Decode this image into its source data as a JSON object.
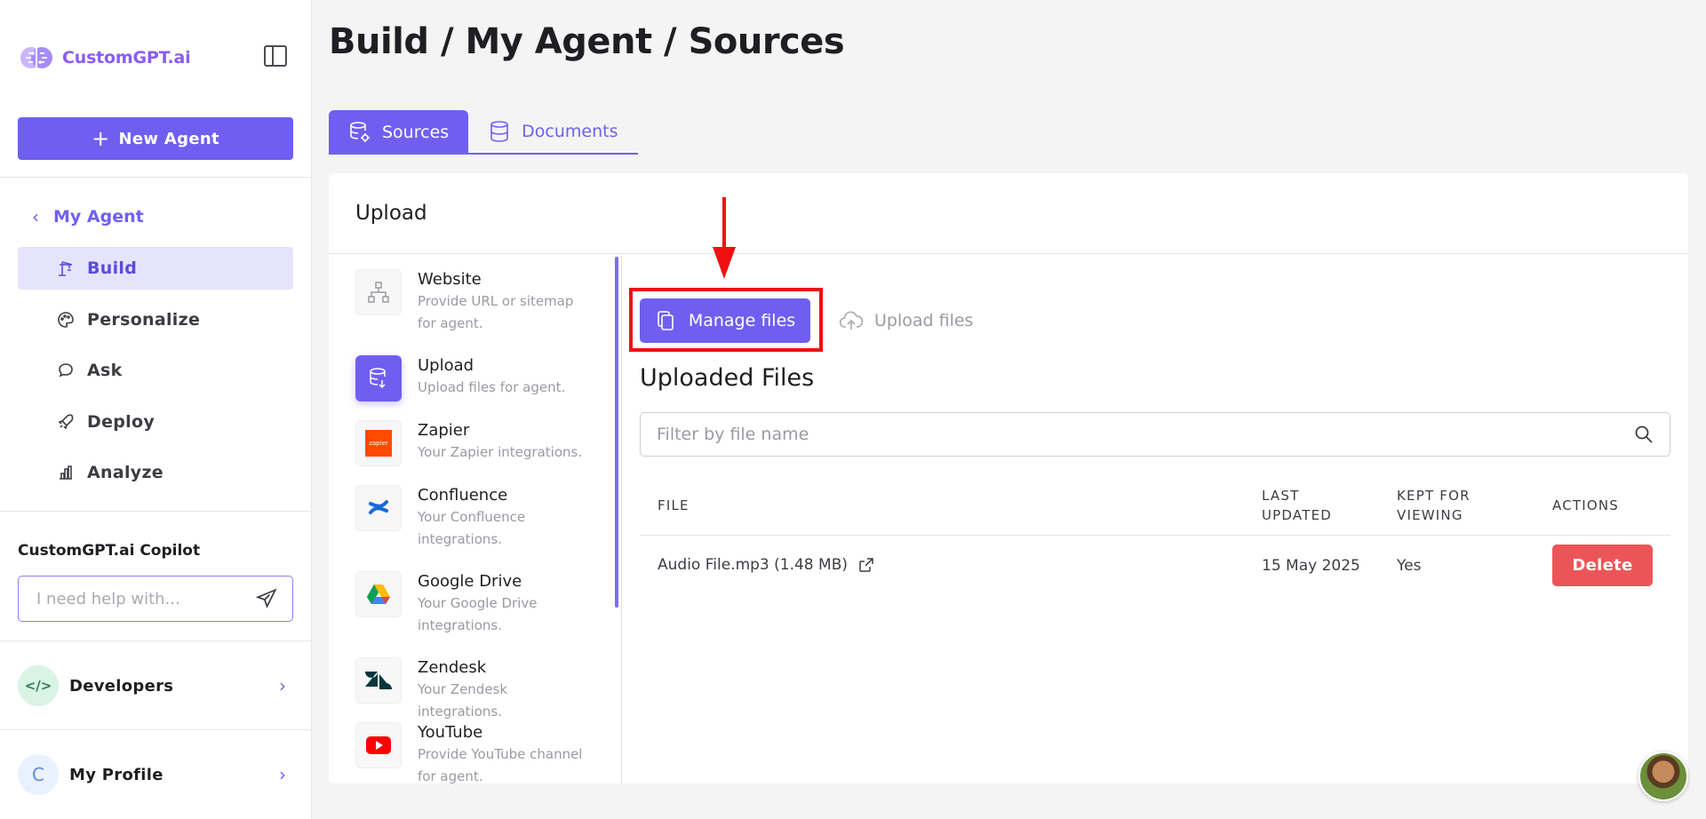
{
  "brand": {
    "name": "CustomGPT.ai"
  },
  "sidebar": {
    "new_agent_label": "New Agent",
    "back_label": "My Agent",
    "items": [
      {
        "label": "Build",
        "icon": "crane-icon",
        "active": true
      },
      {
        "label": "Personalize",
        "icon": "palette-icon",
        "active": false
      },
      {
        "label": "Ask",
        "icon": "chat-icon",
        "active": false
      },
      {
        "label": "Deploy",
        "icon": "rocket-icon",
        "active": false
      },
      {
        "label": "Analyze",
        "icon": "bar-chart-icon",
        "active": false
      }
    ],
    "copilot": {
      "title": "CustomGPT.ai Copilot",
      "placeholder": "I need help with..."
    },
    "developers": {
      "label": "Developers",
      "icon": "code-icon"
    },
    "profile": {
      "label": "My Profile",
      "initial": "C"
    }
  },
  "main": {
    "title": "Build / My Agent / Sources",
    "tabs": [
      {
        "label": "Sources",
        "active": true
      },
      {
        "label": "Documents",
        "active": false
      }
    ],
    "card_title": "Upload",
    "sources": [
      {
        "title": "Website",
        "desc": "Provide URL or sitemap for agent."
      },
      {
        "title": "Upload",
        "desc": "Upload files for agent."
      },
      {
        "title": "Zapier",
        "desc": "Your Zapier integrations.",
        "icon_text": "zapier"
      },
      {
        "title": "Confluence",
        "desc": "Your Confluence integrations."
      },
      {
        "title": "Google Drive",
        "desc": "Your Google Drive integrations."
      },
      {
        "title": "Zendesk",
        "desc": "Your Zendesk integrations."
      },
      {
        "title": "YouTube",
        "desc": "Provide YouTube channel for agent."
      }
    ],
    "manage_files_label": "Manage files",
    "upload_files_label": "Upload files",
    "uploaded_title": "Uploaded Files",
    "filter_placeholder": "Filter by file name",
    "table": {
      "headers": {
        "file": "FILE",
        "last_updated_1": "LAST",
        "last_updated_2": "UPDATED",
        "kept_1": "KEPT FOR",
        "kept_2": "VIEWING",
        "actions": "ACTIONS"
      },
      "rows": [
        {
          "file": "Audio File.mp3 (1.48 MB)",
          "last_updated": "15 May 2025",
          "kept": "Yes",
          "action": "Delete"
        }
      ]
    }
  },
  "colors": {
    "accent": "#6f5ff0",
    "danger": "#ec5558",
    "highlight": "#f01010"
  }
}
